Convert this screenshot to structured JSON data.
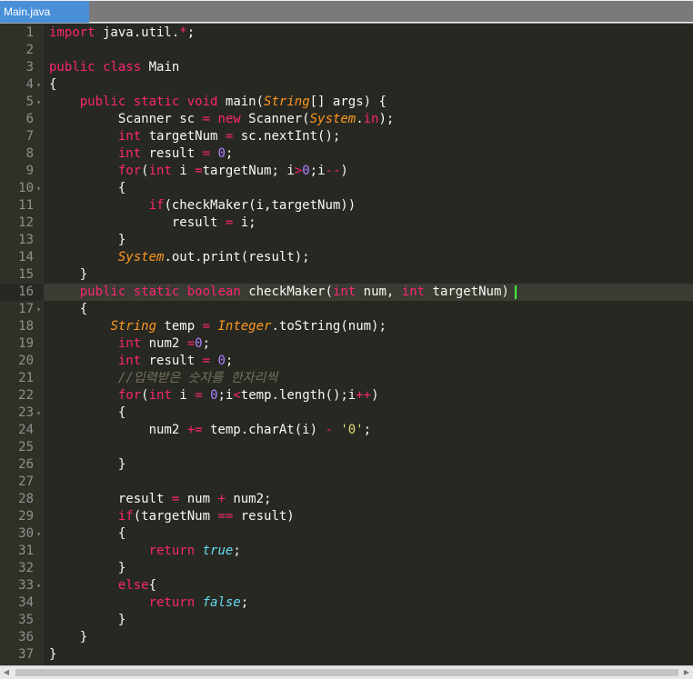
{
  "tab": {
    "label": "Main.java"
  },
  "lines": [
    {
      "n": "1",
      "fold": false,
      "tokens": [
        [
          "kw",
          "import"
        ],
        [
          "plain",
          " java.util."
        ],
        [
          "kw",
          "*"
        ],
        [
          "plain",
          ";"
        ]
      ]
    },
    {
      "n": "2",
      "fold": false,
      "tokens": []
    },
    {
      "n": "3",
      "fold": false,
      "tokens": [
        [
          "kw",
          "public"
        ],
        [
          "plain",
          " "
        ],
        [
          "kw",
          "class"
        ],
        [
          "plain",
          " Main"
        ]
      ]
    },
    {
      "n": "4",
      "fold": true,
      "tokens": [
        [
          "plain",
          "{"
        ]
      ]
    },
    {
      "n": "5",
      "fold": true,
      "tokens": [
        [
          "plain",
          "    "
        ],
        [
          "kw",
          "public"
        ],
        [
          "plain",
          " "
        ],
        [
          "kw",
          "static"
        ],
        [
          "plain",
          " "
        ],
        [
          "kw",
          "void"
        ],
        [
          "plain",
          " main("
        ],
        [
          "cls",
          "String"
        ],
        [
          "plain",
          "[] args) {"
        ]
      ]
    },
    {
      "n": "6",
      "fold": false,
      "tokens": [
        [
          "plain",
          "         Scanner sc "
        ],
        [
          "kw",
          "="
        ],
        [
          "plain",
          " "
        ],
        [
          "kw",
          "new"
        ],
        [
          "plain",
          " Scanner("
        ],
        [
          "cls",
          "System"
        ],
        [
          "plain",
          "."
        ],
        [
          "kw",
          "in"
        ],
        [
          "plain",
          ");"
        ]
      ]
    },
    {
      "n": "7",
      "fold": false,
      "tokens": [
        [
          "plain",
          "         "
        ],
        [
          "kw",
          "int"
        ],
        [
          "plain",
          " targetNum "
        ],
        [
          "kw",
          "="
        ],
        [
          "plain",
          " sc.nextInt();"
        ]
      ]
    },
    {
      "n": "8",
      "fold": false,
      "tokens": [
        [
          "plain",
          "         "
        ],
        [
          "kw",
          "int"
        ],
        [
          "plain",
          " result "
        ],
        [
          "kw",
          "="
        ],
        [
          "plain",
          " "
        ],
        [
          "num-c",
          "0"
        ],
        [
          "plain",
          ";"
        ]
      ]
    },
    {
      "n": "9",
      "fold": false,
      "tokens": [
        [
          "plain",
          "         "
        ],
        [
          "kw",
          "for"
        ],
        [
          "plain",
          "("
        ],
        [
          "kw",
          "int"
        ],
        [
          "plain",
          " i "
        ],
        [
          "kw",
          "="
        ],
        [
          "plain",
          "targetNum; i"
        ],
        [
          "kw",
          ">"
        ],
        [
          "num-c",
          "0"
        ],
        [
          "plain",
          ";i"
        ],
        [
          "kw",
          "--"
        ],
        [
          "plain",
          ")"
        ]
      ]
    },
    {
      "n": "10",
      "fold": true,
      "tokens": [
        [
          "plain",
          "         {"
        ]
      ]
    },
    {
      "n": "11",
      "fold": false,
      "tokens": [
        [
          "plain",
          "             "
        ],
        [
          "kw",
          "if"
        ],
        [
          "plain",
          "(checkMaker(i,targetNum))"
        ]
      ]
    },
    {
      "n": "12",
      "fold": false,
      "tokens": [
        [
          "plain",
          "                result "
        ],
        [
          "kw",
          "="
        ],
        [
          "plain",
          " i;"
        ]
      ]
    },
    {
      "n": "13",
      "fold": false,
      "tokens": [
        [
          "plain",
          "         }"
        ]
      ]
    },
    {
      "n": "14",
      "fold": false,
      "tokens": [
        [
          "plain",
          "         "
        ],
        [
          "cls",
          "System"
        ],
        [
          "plain",
          ".out.print(result);"
        ]
      ]
    },
    {
      "n": "15",
      "fold": false,
      "tokens": [
        [
          "plain",
          "    }"
        ]
      ]
    },
    {
      "n": "16",
      "fold": false,
      "active": true,
      "tokens": [
        [
          "plain",
          "    "
        ],
        [
          "kw",
          "public"
        ],
        [
          "plain",
          " "
        ],
        [
          "kw",
          "static"
        ],
        [
          "plain",
          " "
        ],
        [
          "kw",
          "boolean"
        ],
        [
          "plain",
          " checkMaker("
        ],
        [
          "kw",
          "int"
        ],
        [
          "plain",
          " num, "
        ],
        [
          "kw",
          "int"
        ],
        [
          "plain",
          " targetNum)"
        ]
      ]
    },
    {
      "n": "17",
      "fold": true,
      "tokens": [
        [
          "plain",
          "    {"
        ]
      ]
    },
    {
      "n": "18",
      "fold": false,
      "tokens": [
        [
          "plain",
          "        "
        ],
        [
          "cls",
          "String"
        ],
        [
          "plain",
          " temp "
        ],
        [
          "kw",
          "="
        ],
        [
          "plain",
          " "
        ],
        [
          "cls",
          "Integer"
        ],
        [
          "plain",
          ".toString(num);"
        ]
      ]
    },
    {
      "n": "19",
      "fold": false,
      "tokens": [
        [
          "plain",
          "         "
        ],
        [
          "kw",
          "int"
        ],
        [
          "plain",
          " num2 "
        ],
        [
          "kw",
          "="
        ],
        [
          "num-c",
          "0"
        ],
        [
          "plain",
          ";"
        ]
      ]
    },
    {
      "n": "20",
      "fold": false,
      "tokens": [
        [
          "plain",
          "         "
        ],
        [
          "kw",
          "int"
        ],
        [
          "plain",
          " result "
        ],
        [
          "kw",
          "="
        ],
        [
          "plain",
          " "
        ],
        [
          "num-c",
          "0"
        ],
        [
          "plain",
          ";"
        ]
      ]
    },
    {
      "n": "21",
      "fold": false,
      "tokens": [
        [
          "plain",
          "         "
        ],
        [
          "cm",
          "//입력받은 숫자를 한자리씩"
        ]
      ]
    },
    {
      "n": "22",
      "fold": false,
      "tokens": [
        [
          "plain",
          "         "
        ],
        [
          "kw",
          "for"
        ],
        [
          "plain",
          "("
        ],
        [
          "kw",
          "int"
        ],
        [
          "plain",
          " i "
        ],
        [
          "kw",
          "="
        ],
        [
          "plain",
          " "
        ],
        [
          "num-c",
          "0"
        ],
        [
          "plain",
          ";i"
        ],
        [
          "kw",
          "<"
        ],
        [
          "plain",
          "temp.length();i"
        ],
        [
          "kw",
          "++"
        ],
        [
          "plain",
          ")"
        ]
      ]
    },
    {
      "n": "23",
      "fold": true,
      "tokens": [
        [
          "plain",
          "         {"
        ]
      ]
    },
    {
      "n": "24",
      "fold": false,
      "tokens": [
        [
          "plain",
          "             num2 "
        ],
        [
          "kw",
          "+="
        ],
        [
          "plain",
          " temp.charAt(i) "
        ],
        [
          "kw",
          "-"
        ],
        [
          "plain",
          " "
        ],
        [
          "str",
          "'0'"
        ],
        [
          "plain",
          ";"
        ]
      ]
    },
    {
      "n": "25",
      "fold": false,
      "tokens": []
    },
    {
      "n": "26",
      "fold": false,
      "tokens": [
        [
          "plain",
          "         }"
        ]
      ]
    },
    {
      "n": "27",
      "fold": false,
      "tokens": []
    },
    {
      "n": "28",
      "fold": false,
      "tokens": [
        [
          "plain",
          "         result "
        ],
        [
          "kw",
          "="
        ],
        [
          "plain",
          " num "
        ],
        [
          "kw",
          "+"
        ],
        [
          "plain",
          " num2;"
        ]
      ]
    },
    {
      "n": "29",
      "fold": false,
      "tokens": [
        [
          "plain",
          "         "
        ],
        [
          "kw",
          "if"
        ],
        [
          "plain",
          "(targetNum "
        ],
        [
          "kw",
          "=="
        ],
        [
          "plain",
          " result)"
        ]
      ]
    },
    {
      "n": "30",
      "fold": true,
      "tokens": [
        [
          "plain",
          "         {"
        ]
      ]
    },
    {
      "n": "31",
      "fold": false,
      "tokens": [
        [
          "plain",
          "             "
        ],
        [
          "kw",
          "return"
        ],
        [
          "plain",
          " "
        ],
        [
          "ty",
          "true"
        ],
        [
          "plain",
          ";"
        ]
      ]
    },
    {
      "n": "32",
      "fold": false,
      "tokens": [
        [
          "plain",
          "         }"
        ]
      ]
    },
    {
      "n": "33",
      "fold": true,
      "tokens": [
        [
          "plain",
          "         "
        ],
        [
          "kw",
          "else"
        ],
        [
          "plain",
          "{"
        ]
      ]
    },
    {
      "n": "34",
      "fold": false,
      "tokens": [
        [
          "plain",
          "             "
        ],
        [
          "kw",
          "return"
        ],
        [
          "plain",
          " "
        ],
        [
          "ty",
          "false"
        ],
        [
          "plain",
          ";"
        ]
      ]
    },
    {
      "n": "35",
      "fold": false,
      "tokens": [
        [
          "plain",
          "         }"
        ]
      ]
    },
    {
      "n": "36",
      "fold": false,
      "tokens": [
        [
          "plain",
          "    }"
        ]
      ]
    },
    {
      "n": "37",
      "fold": false,
      "tokens": [
        [
          "plain",
          "}"
        ]
      ]
    }
  ]
}
